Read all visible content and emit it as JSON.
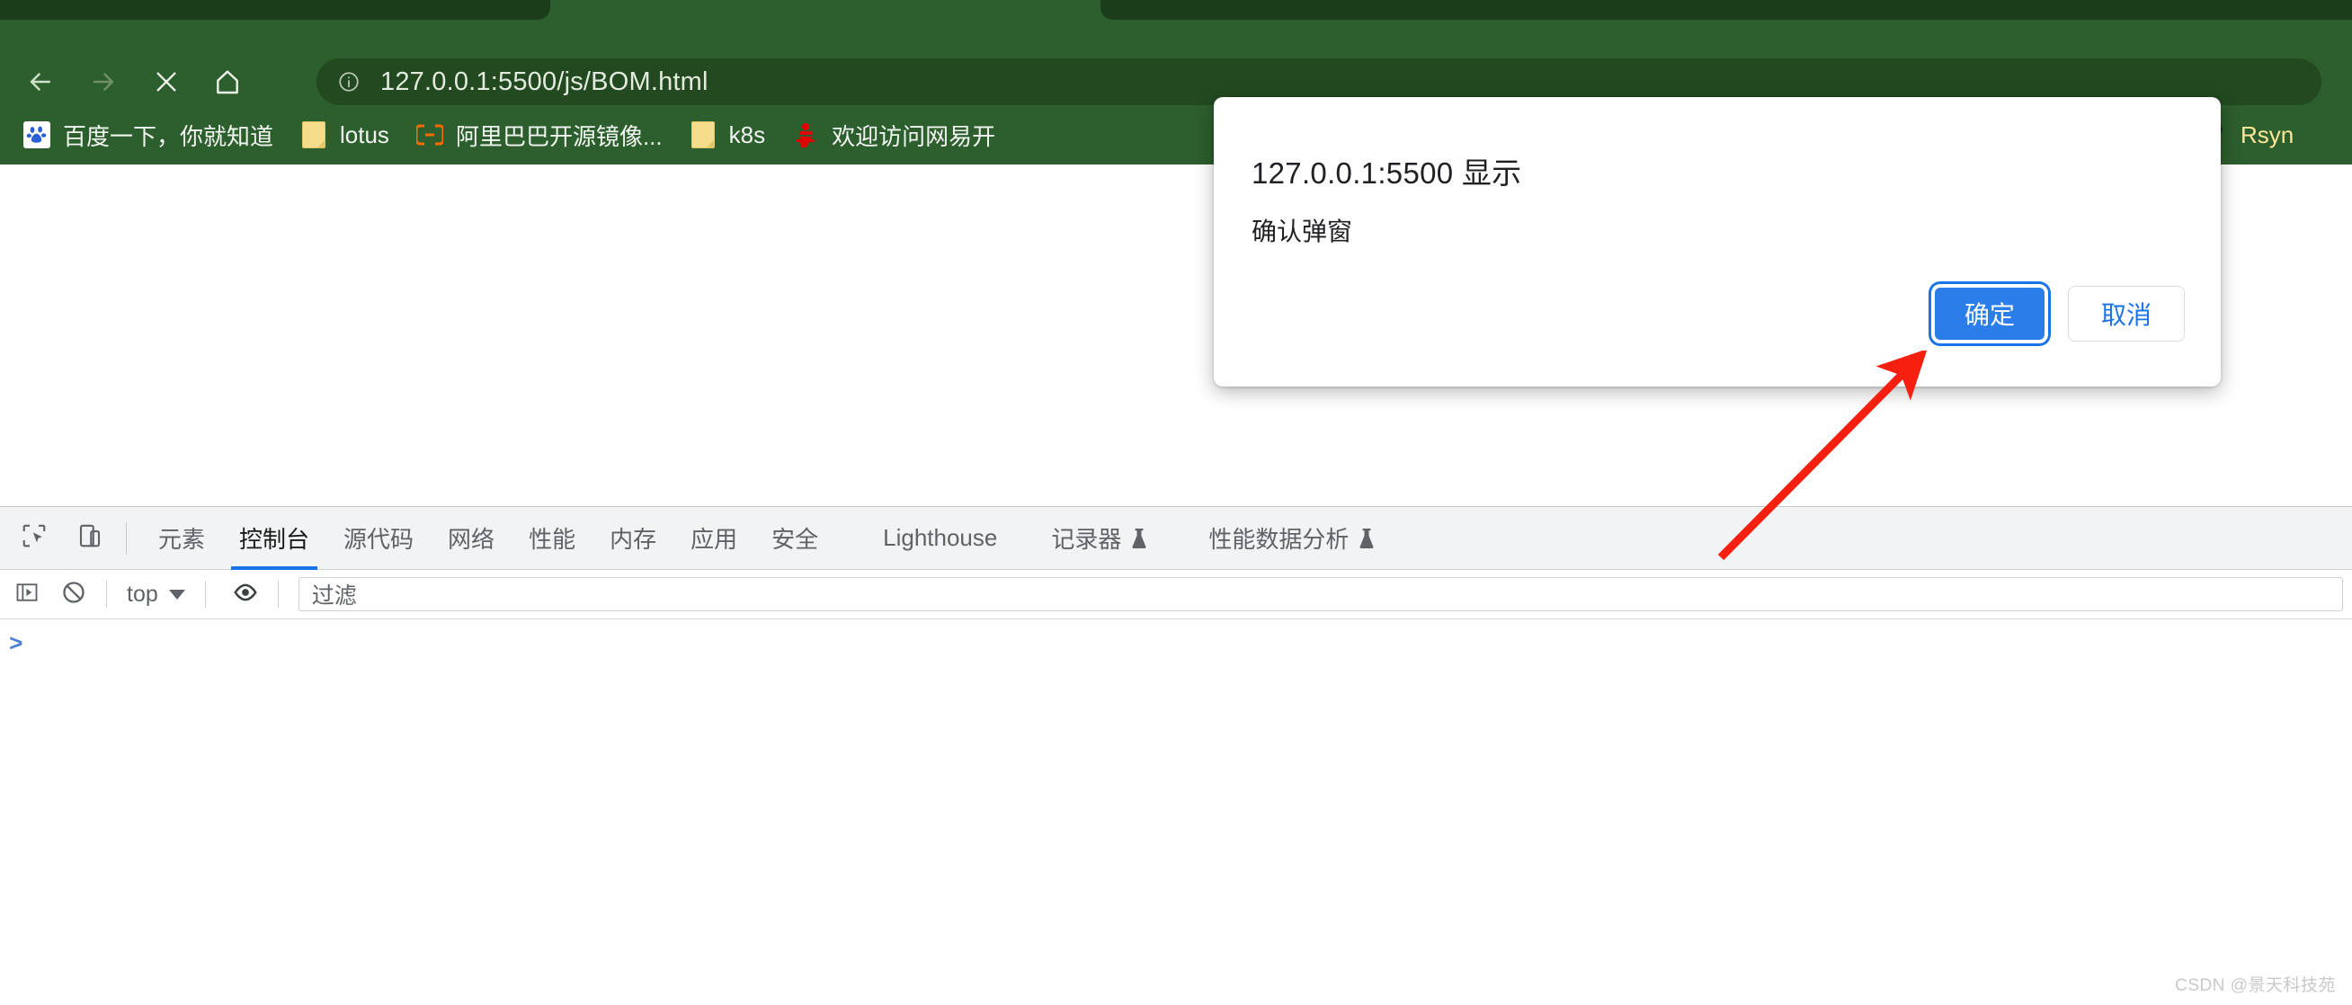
{
  "browser": {
    "theme_color": "#2d5e2d",
    "tab_inactive_color": "#1b3d19",
    "nav": {
      "back_label": "Back",
      "forward_label": "Forward",
      "stop_label": "Stop",
      "home_label": "Home"
    },
    "omnibox": {
      "url": "127.0.0.1:5500/js/BOM.html",
      "security_icon": "info-circle-icon"
    },
    "bookmarks": [
      {
        "label": "百度一下，你就知道",
        "icon": "baidu-favicon"
      },
      {
        "label": "lotus",
        "icon": "folder-icon"
      },
      {
        "label": "阿里巴巴开源镜像...",
        "icon": "aliyun-favicon"
      },
      {
        "label": "k8s",
        "icon": "folder-icon"
      },
      {
        "label": "欢迎访问网易开",
        "icon": "netease-favicon"
      },
      {
        "label": "Rsyn",
        "icon": "rsync-favicon"
      }
    ]
  },
  "dialog": {
    "title": "127.0.0.1:5500 显示",
    "message": "确认弹窗",
    "ok_label": "确定",
    "cancel_label": "取消",
    "ok_color": "#2b7de9",
    "cancel_text_color": "#1a73e8"
  },
  "annotation": {
    "arrow_color": "#f61f10",
    "points_to": "确定"
  },
  "devtools": {
    "tabs": [
      {
        "label": "元素",
        "active": false,
        "experimental": false
      },
      {
        "label": "控制台",
        "active": true,
        "experimental": false
      },
      {
        "label": "源代码",
        "active": false,
        "experimental": false
      },
      {
        "label": "网络",
        "active": false,
        "experimental": false
      },
      {
        "label": "性能",
        "active": false,
        "experimental": false
      },
      {
        "label": "内存",
        "active": false,
        "experimental": false
      },
      {
        "label": "应用",
        "active": false,
        "experimental": false
      },
      {
        "label": "安全",
        "active": false,
        "experimental": false
      },
      {
        "label": "Lighthouse",
        "active": false,
        "experimental": false
      },
      {
        "label": "记录器",
        "active": false,
        "experimental": true
      },
      {
        "label": "性能数据分析",
        "active": false,
        "experimental": true
      }
    ],
    "inspect_icon": "inspect-element-icon",
    "device_icon": "device-toolbar-icon",
    "console": {
      "sidebar_icon": "console-sidebar-icon",
      "clear_icon": "clear-console-icon",
      "context_value": "top",
      "eye_icon": "live-expression-icon",
      "filter_placeholder": "过滤",
      "prompt_symbol": ">"
    },
    "accent_color": "#1a73e8"
  },
  "watermark": {
    "text": "CSDN @景天科技苑"
  }
}
